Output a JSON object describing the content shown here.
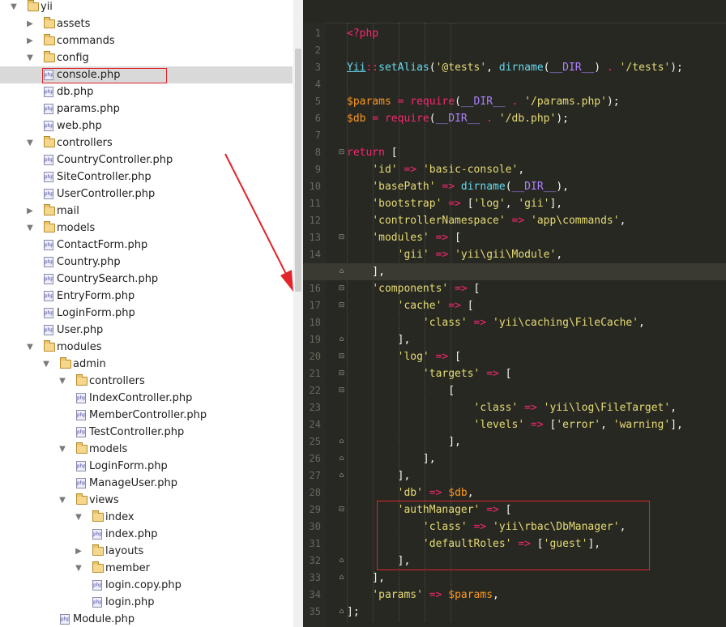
{
  "project_tree": {
    "items": [
      {
        "label": "yii",
        "type": "folder",
        "expanded": true,
        "level": 0
      },
      {
        "label": "assets",
        "type": "folder",
        "expanded": false,
        "level": 1
      },
      {
        "label": "commands",
        "type": "folder",
        "expanded": false,
        "level": 1
      },
      {
        "label": "config",
        "type": "folder",
        "expanded": true,
        "level": 1
      },
      {
        "label": "console.php",
        "type": "php",
        "level": 2,
        "selected": true
      },
      {
        "label": "db.php",
        "type": "php",
        "level": 2
      },
      {
        "label": "params.php",
        "type": "php",
        "level": 2
      },
      {
        "label": "web.php",
        "type": "php",
        "level": 2
      },
      {
        "label": "controllers",
        "type": "folder",
        "expanded": true,
        "level": 1
      },
      {
        "label": "CountryController.php",
        "type": "php",
        "level": 2
      },
      {
        "label": "SiteController.php",
        "type": "php",
        "level": 2
      },
      {
        "label": "UserController.php",
        "type": "php",
        "level": 2
      },
      {
        "label": "mail",
        "type": "folder",
        "expanded": false,
        "level": 1
      },
      {
        "label": "models",
        "type": "folder",
        "expanded": true,
        "level": 1
      },
      {
        "label": "ContactForm.php",
        "type": "php",
        "level": 2
      },
      {
        "label": "Country.php",
        "type": "php",
        "level": 2
      },
      {
        "label": "CountrySearch.php",
        "type": "php",
        "level": 2
      },
      {
        "label": "EntryForm.php",
        "type": "php",
        "level": 2
      },
      {
        "label": "LoginForm.php",
        "type": "php",
        "level": 2
      },
      {
        "label": "User.php",
        "type": "php",
        "level": 2
      },
      {
        "label": "modules",
        "type": "folder",
        "expanded": true,
        "level": 1
      },
      {
        "label": "admin",
        "type": "folder",
        "expanded": true,
        "level": 2
      },
      {
        "label": "controllers",
        "type": "folder",
        "expanded": true,
        "level": 3
      },
      {
        "label": "IndexController.php",
        "type": "php",
        "level": 4
      },
      {
        "label": "MemberController.php",
        "type": "php",
        "level": 4
      },
      {
        "label": "TestController.php",
        "type": "php",
        "level": 4
      },
      {
        "label": "models",
        "type": "folder",
        "expanded": true,
        "level": 3
      },
      {
        "label": "LoginForm.php",
        "type": "php",
        "level": 4
      },
      {
        "label": "ManageUser.php",
        "type": "php",
        "level": 4
      },
      {
        "label": "views",
        "type": "folder",
        "expanded": true,
        "level": 3
      },
      {
        "label": "index",
        "type": "folder",
        "expanded": true,
        "level": 4
      },
      {
        "label": "index.php",
        "type": "php",
        "level": 5
      },
      {
        "label": "layouts",
        "type": "folder",
        "expanded": false,
        "level": 4
      },
      {
        "label": "member",
        "type": "folder",
        "expanded": true,
        "level": 4
      },
      {
        "label": "login.copy.php",
        "type": "php",
        "level": 5
      },
      {
        "label": "login.php",
        "type": "php",
        "level": 5
      },
      {
        "label": "Module.php",
        "type": "php",
        "level": 3
      }
    ]
  },
  "editor": {
    "active_line": 15,
    "lines": [
      {
        "n": "1",
        "tokens": [
          [
            "t-tag",
            "<?php"
          ]
        ]
      },
      {
        "n": "2",
        "tokens": []
      },
      {
        "n": "3",
        "tokens": [
          [
            "t-cls",
            "Yii"
          ],
          [
            "t-op",
            "::"
          ],
          [
            "t-fn",
            "setAlias"
          ],
          [
            "t-pun",
            "("
          ],
          [
            "t-str",
            "'@tests'"
          ],
          [
            "t-pun",
            ", "
          ],
          [
            "t-fn",
            "dirname"
          ],
          [
            "t-pun",
            "("
          ],
          [
            "t-const",
            "__DIR__"
          ],
          [
            "t-pun",
            ") "
          ],
          [
            "t-op",
            "."
          ],
          [
            "t-pun",
            " "
          ],
          [
            "t-str",
            "'/tests'"
          ],
          [
            "t-pun",
            ");"
          ]
        ]
      },
      {
        "n": "4",
        "tokens": []
      },
      {
        "n": "5",
        "tokens": [
          [
            "t-var",
            "$params"
          ],
          [
            "t-pun",
            " "
          ],
          [
            "t-op",
            "="
          ],
          [
            "t-pun",
            " "
          ],
          [
            "t-kw",
            "require"
          ],
          [
            "t-pun",
            "("
          ],
          [
            "t-const",
            "__DIR__"
          ],
          [
            "t-pun",
            " "
          ],
          [
            "t-op",
            "."
          ],
          [
            "t-pun",
            " "
          ],
          [
            "t-str",
            "'/params.php'"
          ],
          [
            "t-pun",
            ");"
          ]
        ]
      },
      {
        "n": "6",
        "tokens": [
          [
            "t-var",
            "$db"
          ],
          [
            "t-pun",
            " "
          ],
          [
            "t-op",
            "="
          ],
          [
            "t-pun",
            " "
          ],
          [
            "t-kw",
            "require"
          ],
          [
            "t-pun",
            "("
          ],
          [
            "t-const",
            "__DIR__"
          ],
          [
            "t-pun",
            " "
          ],
          [
            "t-op",
            "."
          ],
          [
            "t-pun",
            " "
          ],
          [
            "t-str",
            "'/db.php'"
          ],
          [
            "t-pun",
            ");"
          ]
        ]
      },
      {
        "n": "7",
        "tokens": []
      },
      {
        "n": "8",
        "tokens": [
          [
            "t-kw",
            "return"
          ],
          [
            "t-pun",
            " ["
          ]
        ]
      },
      {
        "n": "9",
        "tokens": [
          [
            "t-pun",
            "    "
          ],
          [
            "t-str",
            "'id'"
          ],
          [
            "t-pun",
            " "
          ],
          [
            "t-op",
            "=>"
          ],
          [
            "t-pun",
            " "
          ],
          [
            "t-str",
            "'basic-console'"
          ],
          [
            "t-pun",
            ","
          ]
        ]
      },
      {
        "n": "10",
        "tokens": [
          [
            "t-pun",
            "    "
          ],
          [
            "t-str",
            "'basePath'"
          ],
          [
            "t-pun",
            " "
          ],
          [
            "t-op",
            "=>"
          ],
          [
            "t-pun",
            " "
          ],
          [
            "t-fn",
            "dirname"
          ],
          [
            "t-pun",
            "("
          ],
          [
            "t-const",
            "__DIR__"
          ],
          [
            "t-pun",
            "),"
          ]
        ]
      },
      {
        "n": "11",
        "tokens": [
          [
            "t-pun",
            "    "
          ],
          [
            "t-str",
            "'bootstrap'"
          ],
          [
            "t-pun",
            " "
          ],
          [
            "t-op",
            "=>"
          ],
          [
            "t-pun",
            " ["
          ],
          [
            "t-str",
            "'log'"
          ],
          [
            "t-pun",
            ", "
          ],
          [
            "t-str",
            "'gii'"
          ],
          [
            "t-pun",
            "],"
          ]
        ]
      },
      {
        "n": "12",
        "tokens": [
          [
            "t-pun",
            "    "
          ],
          [
            "t-str",
            "'controllerNamespace'"
          ],
          [
            "t-pun",
            " "
          ],
          [
            "t-op",
            "=>"
          ],
          [
            "t-pun",
            " "
          ],
          [
            "t-str",
            "'app\\commands'"
          ],
          [
            "t-pun",
            ","
          ]
        ]
      },
      {
        "n": "13",
        "tokens": [
          [
            "t-pun",
            "    "
          ],
          [
            "t-str",
            "'modules'"
          ],
          [
            "t-pun",
            " "
          ],
          [
            "t-op",
            "=>"
          ],
          [
            "t-pun",
            " ["
          ]
        ]
      },
      {
        "n": "14",
        "tokens": [
          [
            "t-pun",
            "        "
          ],
          [
            "t-str",
            "'gii'"
          ],
          [
            "t-pun",
            " "
          ],
          [
            "t-op",
            "=>"
          ],
          [
            "t-pun",
            " "
          ],
          [
            "t-str",
            "'yii\\gii\\Module'"
          ],
          [
            "t-pun",
            ","
          ]
        ]
      },
      {
        "n": "15",
        "tokens": [
          [
            "t-pun",
            "    ],"
          ]
        ]
      },
      {
        "n": "16",
        "tokens": [
          [
            "t-pun",
            "    "
          ],
          [
            "t-str",
            "'components'"
          ],
          [
            "t-pun",
            " "
          ],
          [
            "t-op",
            "=>"
          ],
          [
            "t-pun",
            " ["
          ]
        ]
      },
      {
        "n": "17",
        "tokens": [
          [
            "t-pun",
            "        "
          ],
          [
            "t-str",
            "'cache'"
          ],
          [
            "t-pun",
            " "
          ],
          [
            "t-op",
            "=>"
          ],
          [
            "t-pun",
            " ["
          ]
        ]
      },
      {
        "n": "18",
        "tokens": [
          [
            "t-pun",
            "            "
          ],
          [
            "t-str",
            "'class'"
          ],
          [
            "t-pun",
            " "
          ],
          [
            "t-op",
            "=>"
          ],
          [
            "t-pun",
            " "
          ],
          [
            "t-str",
            "'yii\\caching\\FileCache'"
          ],
          [
            "t-pun",
            ","
          ]
        ]
      },
      {
        "n": "19",
        "tokens": [
          [
            "t-pun",
            "        ],"
          ]
        ]
      },
      {
        "n": "20",
        "tokens": [
          [
            "t-pun",
            "        "
          ],
          [
            "t-str",
            "'log'"
          ],
          [
            "t-pun",
            " "
          ],
          [
            "t-op",
            "=>"
          ],
          [
            "t-pun",
            " ["
          ]
        ]
      },
      {
        "n": "21",
        "tokens": [
          [
            "t-pun",
            "            "
          ],
          [
            "t-str",
            "'targets'"
          ],
          [
            "t-pun",
            " "
          ],
          [
            "t-op",
            "=>"
          ],
          [
            "t-pun",
            " ["
          ]
        ]
      },
      {
        "n": "22",
        "tokens": [
          [
            "t-pun",
            "                ["
          ]
        ]
      },
      {
        "n": "23",
        "tokens": [
          [
            "t-pun",
            "                    "
          ],
          [
            "t-str",
            "'class'"
          ],
          [
            "t-pun",
            " "
          ],
          [
            "t-op",
            "=>"
          ],
          [
            "t-pun",
            " "
          ],
          [
            "t-str",
            "'yii\\log\\FileTarget'"
          ],
          [
            "t-pun",
            ","
          ]
        ]
      },
      {
        "n": "24",
        "tokens": [
          [
            "t-pun",
            "                    "
          ],
          [
            "t-str",
            "'levels'"
          ],
          [
            "t-pun",
            " "
          ],
          [
            "t-op",
            "=>"
          ],
          [
            "t-pun",
            " ["
          ],
          [
            "t-str",
            "'error'"
          ],
          [
            "t-pun",
            ", "
          ],
          [
            "t-str",
            "'warning'"
          ],
          [
            "t-pun",
            "],"
          ]
        ]
      },
      {
        "n": "25",
        "tokens": [
          [
            "t-pun",
            "                ],"
          ]
        ]
      },
      {
        "n": "26",
        "tokens": [
          [
            "t-pun",
            "            ],"
          ]
        ]
      },
      {
        "n": "27",
        "tokens": [
          [
            "t-pun",
            "        ],"
          ]
        ]
      },
      {
        "n": "28",
        "tokens": [
          [
            "t-pun",
            "        "
          ],
          [
            "t-str",
            "'db'"
          ],
          [
            "t-pun",
            " "
          ],
          [
            "t-op",
            "=>"
          ],
          [
            "t-pun",
            " "
          ],
          [
            "t-var",
            "$db"
          ],
          [
            "t-pun",
            ","
          ]
        ]
      },
      {
        "n": "29",
        "tokens": [
          [
            "t-pun",
            "        "
          ],
          [
            "t-str",
            "'authManager'"
          ],
          [
            "t-pun",
            " "
          ],
          [
            "t-op",
            "=>"
          ],
          [
            "t-pun",
            " ["
          ]
        ]
      },
      {
        "n": "30",
        "tokens": [
          [
            "t-pun",
            "            "
          ],
          [
            "t-str",
            "'class'"
          ],
          [
            "t-pun",
            " "
          ],
          [
            "t-op",
            "=>"
          ],
          [
            "t-pun",
            " "
          ],
          [
            "t-str",
            "'yii\\rbac\\DbManager'"
          ],
          [
            "t-pun",
            ","
          ]
        ]
      },
      {
        "n": "31",
        "tokens": [
          [
            "t-pun",
            "            "
          ],
          [
            "t-str",
            "'defaultRoles'"
          ],
          [
            "t-pun",
            " "
          ],
          [
            "t-op",
            "=>"
          ],
          [
            "t-pun",
            " ["
          ],
          [
            "t-str",
            "'guest'"
          ],
          [
            "t-pun",
            "],"
          ]
        ]
      },
      {
        "n": "32",
        "tokens": [
          [
            "t-pun",
            "        ],"
          ]
        ]
      },
      {
        "n": "33",
        "tokens": [
          [
            "t-pun",
            "    ],"
          ]
        ]
      },
      {
        "n": "34",
        "tokens": [
          [
            "t-pun",
            "    "
          ],
          [
            "t-str",
            "'params'"
          ],
          [
            "t-pun",
            " "
          ],
          [
            "t-op",
            "=>"
          ],
          [
            "t-pun",
            " "
          ],
          [
            "t-var",
            "$params"
          ],
          [
            "t-pun",
            ","
          ]
        ]
      },
      {
        "n": "35",
        "tokens": [
          [
            "t-pun",
            "];"
          ]
        ]
      }
    ]
  }
}
